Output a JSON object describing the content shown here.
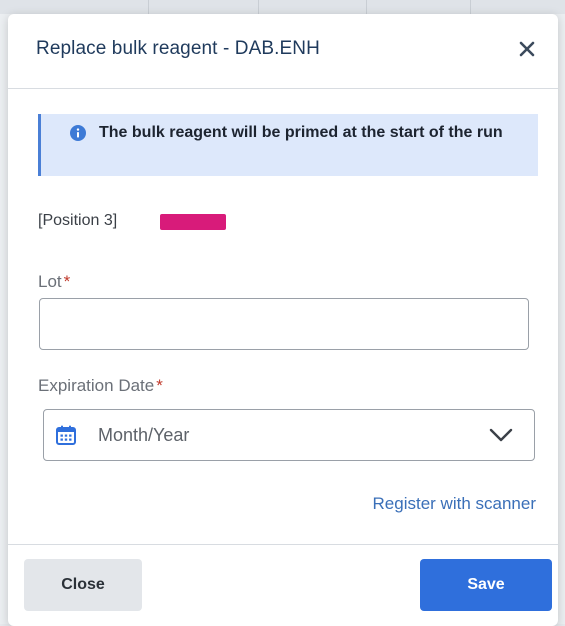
{
  "dialog": {
    "title": "Replace bulk reagent - DAB.ENH",
    "close_icon": "close-icon"
  },
  "info_banner": {
    "icon": "info-icon",
    "text": "The bulk reagent will be primed at the start of the run"
  },
  "position": {
    "label": "[Position 3]",
    "swatch_color": "#d81b7a"
  },
  "lot": {
    "label": "Lot",
    "required_marker": "*",
    "value": "",
    "placeholder": ""
  },
  "expiration": {
    "label": "Expiration Date",
    "required_marker": "*",
    "placeholder": "Month/Year",
    "icon": "calendar-icon",
    "dropdown_icon": "chevron-down-icon"
  },
  "scanner_link": "Register with scanner",
  "footer": {
    "close_label": "Close",
    "save_label": "Save"
  },
  "colors": {
    "primary": "#2f6fdc",
    "title": "#1f3a5c",
    "banner_bg": "#dde8fb",
    "banner_border": "#4a7fd6",
    "required": "#c0392b",
    "link": "#3a6fb8"
  }
}
